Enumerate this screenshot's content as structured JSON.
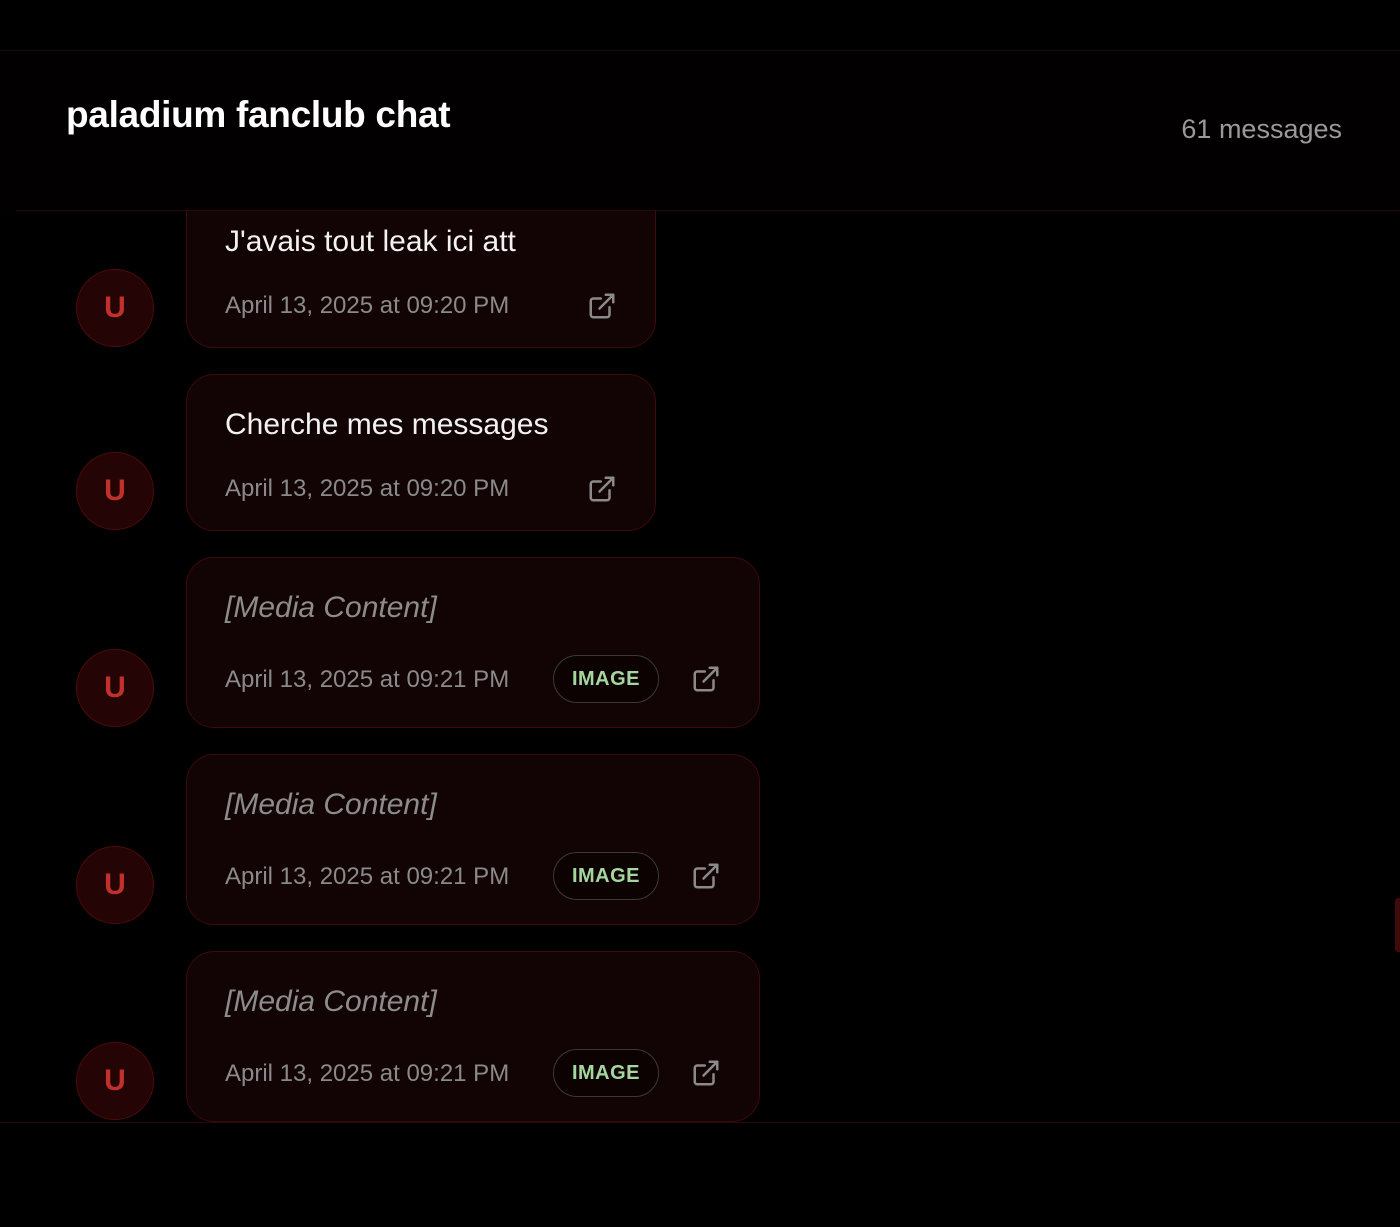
{
  "header": {
    "title": "paladium fanclub chat",
    "count": "61 messages"
  },
  "messages": [
    {
      "avatar": "U",
      "text": "J'avais tout leak ici att",
      "timestamp": "April 13, 2025 at 09:20 PM",
      "icon": "external-link-icon"
    },
    {
      "avatar": "U",
      "text": "Cherche mes messages",
      "timestamp": "April 13, 2025 at 09:20 PM",
      "icon": "external-link-icon"
    },
    {
      "avatar": "U",
      "text": "[Media Content]",
      "timestamp": "April 13, 2025 at 09:21 PM",
      "badge": "IMAGE",
      "icon": "external-link-icon"
    },
    {
      "avatar": "U",
      "text": "[Media Content]",
      "timestamp": "April 13, 2025 at 09:21 PM",
      "badge": "IMAGE",
      "icon": "external-link-icon"
    },
    {
      "avatar": "U",
      "text": "[Media Content]",
      "timestamp": "April 13, 2025 at 09:21 PM",
      "badge": "IMAGE",
      "icon": "external-link-icon"
    }
  ],
  "colors": {
    "background": "#000000",
    "bubble": "#120304",
    "bubble_border": "#3e0a0a",
    "avatar_text": "#c0302c",
    "badge_text": "#a6d6a0"
  }
}
